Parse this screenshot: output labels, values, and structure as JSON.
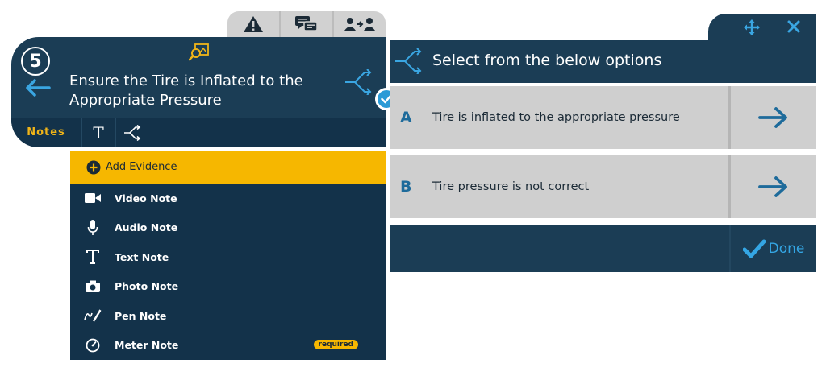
{
  "step": {
    "number": "5",
    "title": "Ensure the Tire is Inflated to the Appropriate Pressure"
  },
  "top_tabs": [
    "warning-icon",
    "comments-icon",
    "handoff-icon"
  ],
  "toolbar": {
    "notes_label": "Notes",
    "text_button": "T"
  },
  "evidence_menu": {
    "add_label": "Add Evidence",
    "items": [
      {
        "label": "Video Note",
        "icon": "video-camera-icon"
      },
      {
        "label": "Audio Note",
        "icon": "microphone-icon"
      },
      {
        "label": "Text Note",
        "icon": "text-icon"
      },
      {
        "label": "Photo Note",
        "icon": "camera-icon"
      },
      {
        "label": "Pen Note",
        "icon": "pen-icon"
      },
      {
        "label": "Meter Note",
        "icon": "meter-icon",
        "badge": "required"
      }
    ]
  },
  "decision_panel": {
    "header": "Select from the below options",
    "options": [
      {
        "letter": "A",
        "text": "Tire is inflated to the appropriate pressure"
      },
      {
        "letter": "B",
        "text": "Tire pressure is not correct"
      }
    ],
    "done_label": "Done"
  },
  "colors": {
    "navy": "#1b3d55",
    "navy_dark": "#13324a",
    "accent_yellow": "#f6b700",
    "accent_blue": "#2a9ad6",
    "option_grey": "#cfcfcf"
  }
}
